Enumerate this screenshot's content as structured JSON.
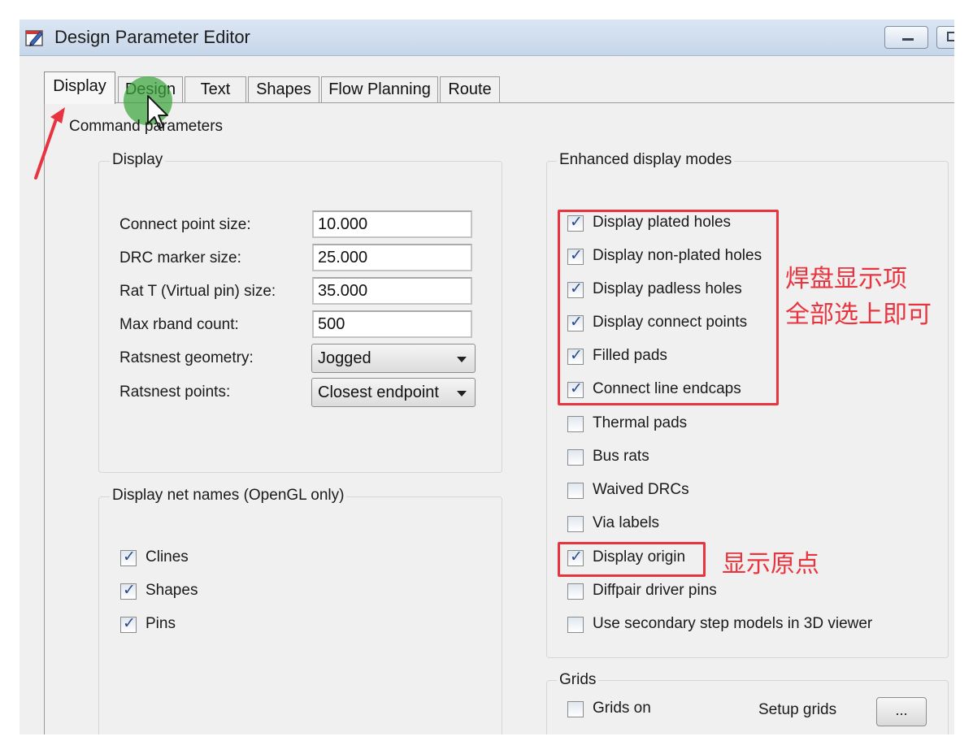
{
  "window": {
    "title": "Design Parameter Editor"
  },
  "tabs": [
    {
      "label": "Display",
      "active": true
    },
    {
      "label": "Design"
    },
    {
      "label": "Text"
    },
    {
      "label": "Shapes"
    },
    {
      "label": "Flow Planning"
    },
    {
      "label": "Route"
    }
  ],
  "command_parameters": {
    "label": "Command parameters",
    "display_group": {
      "label": "Display",
      "fields": [
        {
          "label": "Connect point size:",
          "value": "10.000"
        },
        {
          "label": "DRC marker size:",
          "value": "25.000"
        },
        {
          "label": "Rat T (Virtual pin) size:",
          "value": "35.000"
        },
        {
          "label": "Max rband count:",
          "value": "500"
        }
      ],
      "selects": [
        {
          "label": "Ratsnest geometry:",
          "value": "Jogged"
        },
        {
          "label": "Ratsnest points:",
          "value": "Closest endpoint"
        }
      ]
    },
    "net_names_group": {
      "label": "Display net names (OpenGL only)",
      "items": [
        {
          "label": "Clines",
          "checked": true
        },
        {
          "label": "Shapes",
          "checked": true
        },
        {
          "label": "Pins",
          "checked": true
        }
      ]
    },
    "enhanced_group": {
      "label": "Enhanced display modes",
      "items": [
        {
          "label": "Display plated holes",
          "checked": true
        },
        {
          "label": "Display non-plated holes",
          "checked": true
        },
        {
          "label": "Display padless holes",
          "checked": true
        },
        {
          "label": "Display connect points",
          "checked": true
        },
        {
          "label": "Filled pads",
          "checked": true
        },
        {
          "label": "Connect line endcaps",
          "checked": true
        },
        {
          "label": "Thermal pads",
          "checked": false
        },
        {
          "label": "Bus rats",
          "checked": false
        },
        {
          "label": "Waived DRCs",
          "checked": false
        },
        {
          "label": "Via labels",
          "checked": false
        },
        {
          "label": "Display origin",
          "checked": true
        },
        {
          "label": "Diffpair driver pins",
          "checked": false
        },
        {
          "label": "Use secondary step models in 3D viewer",
          "checked": false
        }
      ]
    },
    "grids_group": {
      "label": "Grids",
      "grids_on": {
        "label": "Grids on",
        "checked": false
      },
      "setup_label": "Setup grids",
      "setup_button": "..."
    }
  },
  "annotations": {
    "pad_note_line1": "焊盘显示项",
    "pad_note_line2": "全部选上即可",
    "origin_note": "显示原点",
    "highlight_color": "#e8343e"
  },
  "check_mark": "✓"
}
